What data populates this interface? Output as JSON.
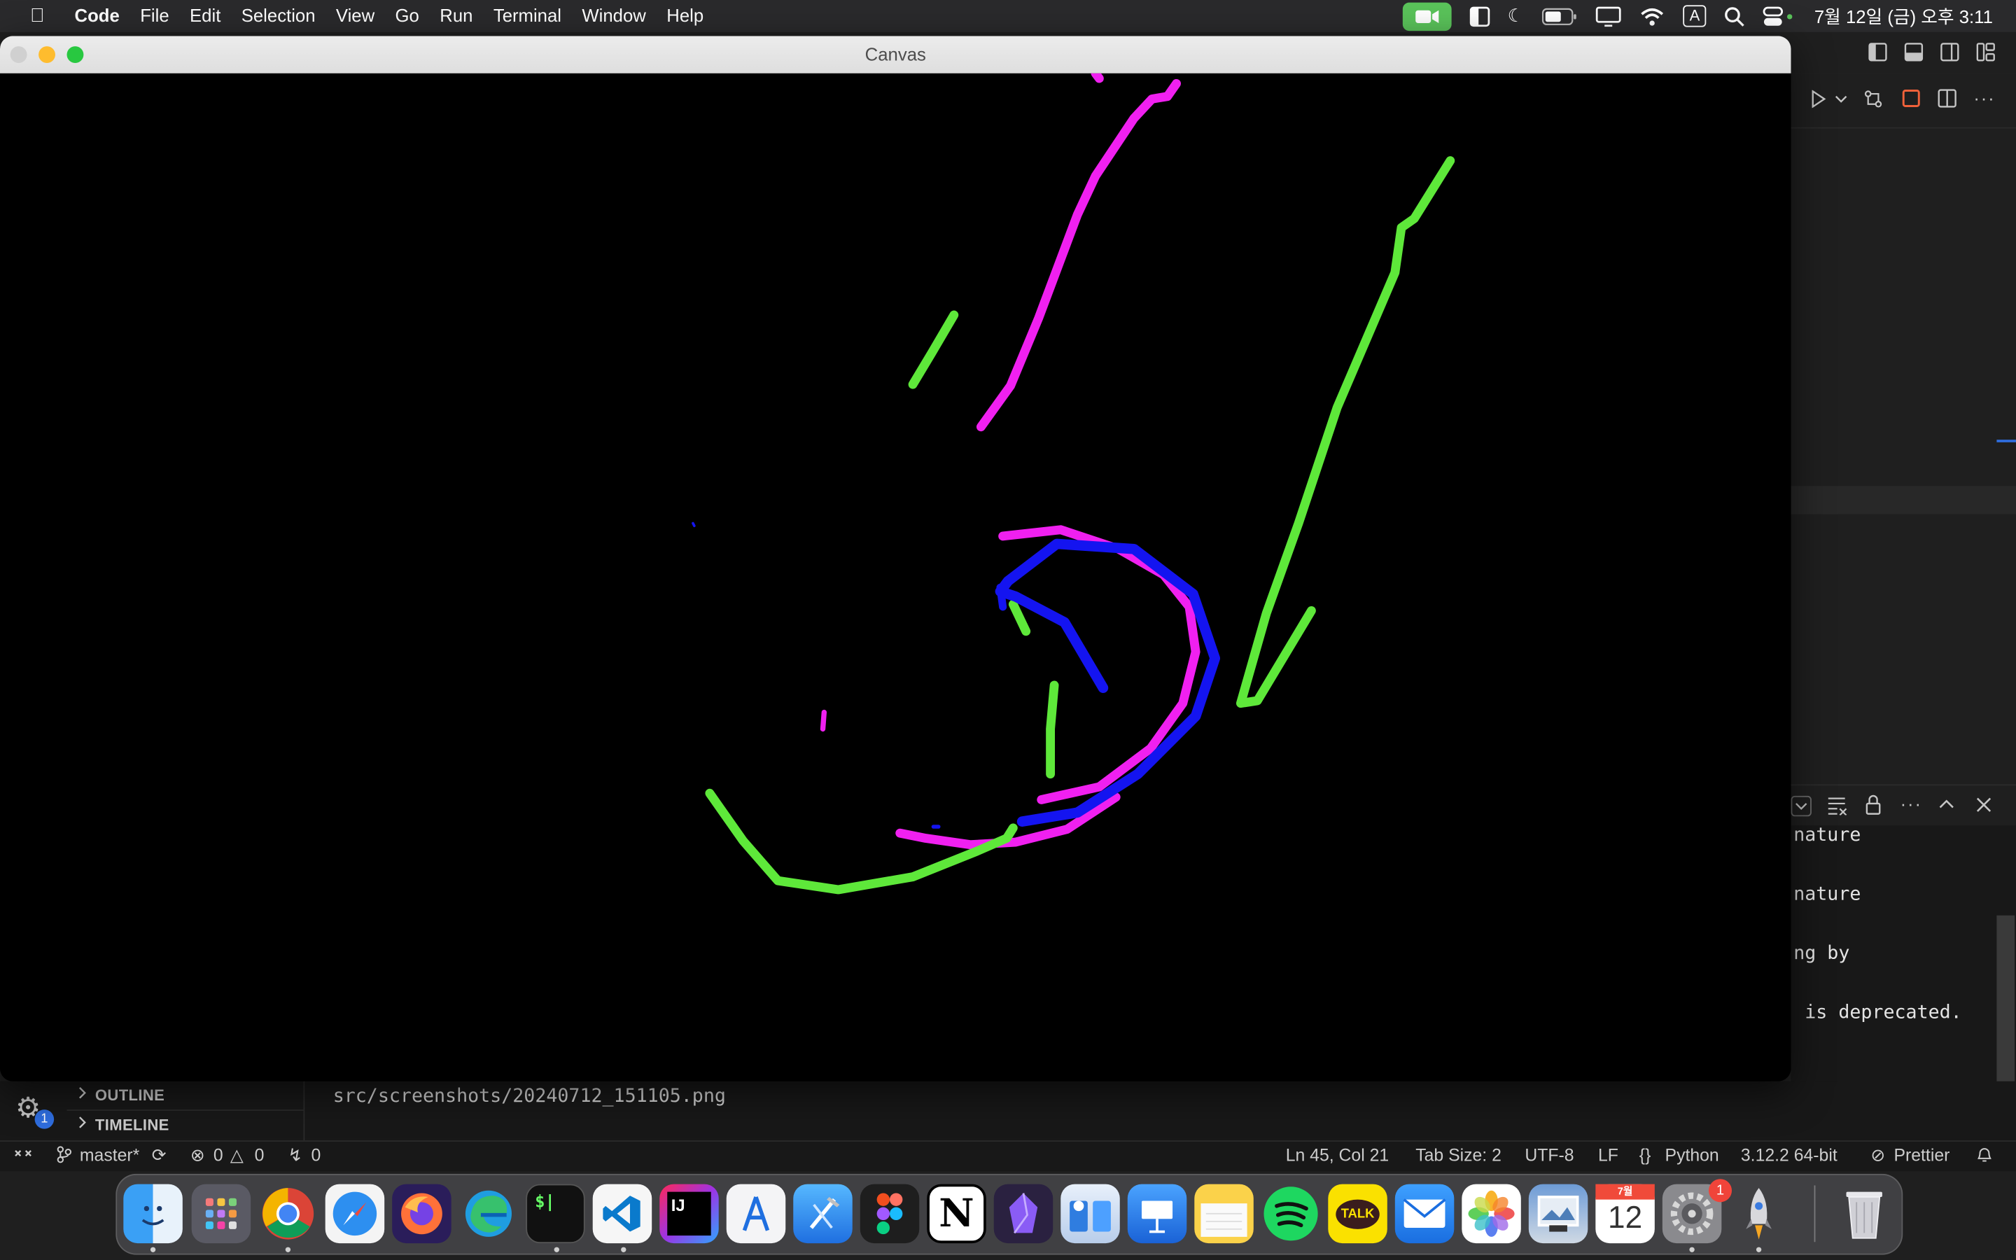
{
  "menubar": {
    "app": "Code",
    "items": [
      "File",
      "Edit",
      "Selection",
      "View",
      "Go",
      "Run",
      "Terminal",
      "Window",
      "Help"
    ],
    "clock": "7월 12일 (금) 오후 3:11",
    "input_source": "A"
  },
  "canvas_window": {
    "title": "Canvas"
  },
  "terminal": {
    "lines": [
      "nature",
      "nature",
      "ng by",
      " is deprecated."
    ],
    "path": "src/screenshots/20240712_151105.png"
  },
  "sidebar": {
    "outline": "OUTLINE",
    "timeline": "TIMELINE",
    "badge": "1"
  },
  "statusbar": {
    "branch": "master*",
    "errors": "0",
    "warnings": "0",
    "ports": "0",
    "cursor": "Ln 45, Col 21",
    "tab_size": "Tab Size: 2",
    "encoding": "UTF-8",
    "eol": "LF",
    "language": "Python",
    "interpreter": "3.12.2 64-bit",
    "formatter": "Prettier"
  },
  "dock": {
    "calendar_month": "7월",
    "calendar_day": "12",
    "settings_badge": "1",
    "intellij_label": "IJ",
    "notion_label": "N",
    "terminal_label": "$|",
    "kakao_label": "TALK"
  },
  "colors": {
    "stroke_magenta": "#f020f0",
    "stroke_green": "#5ee83a",
    "stroke_blue": "#1414f0",
    "canvas_bg": "#000000"
  }
}
